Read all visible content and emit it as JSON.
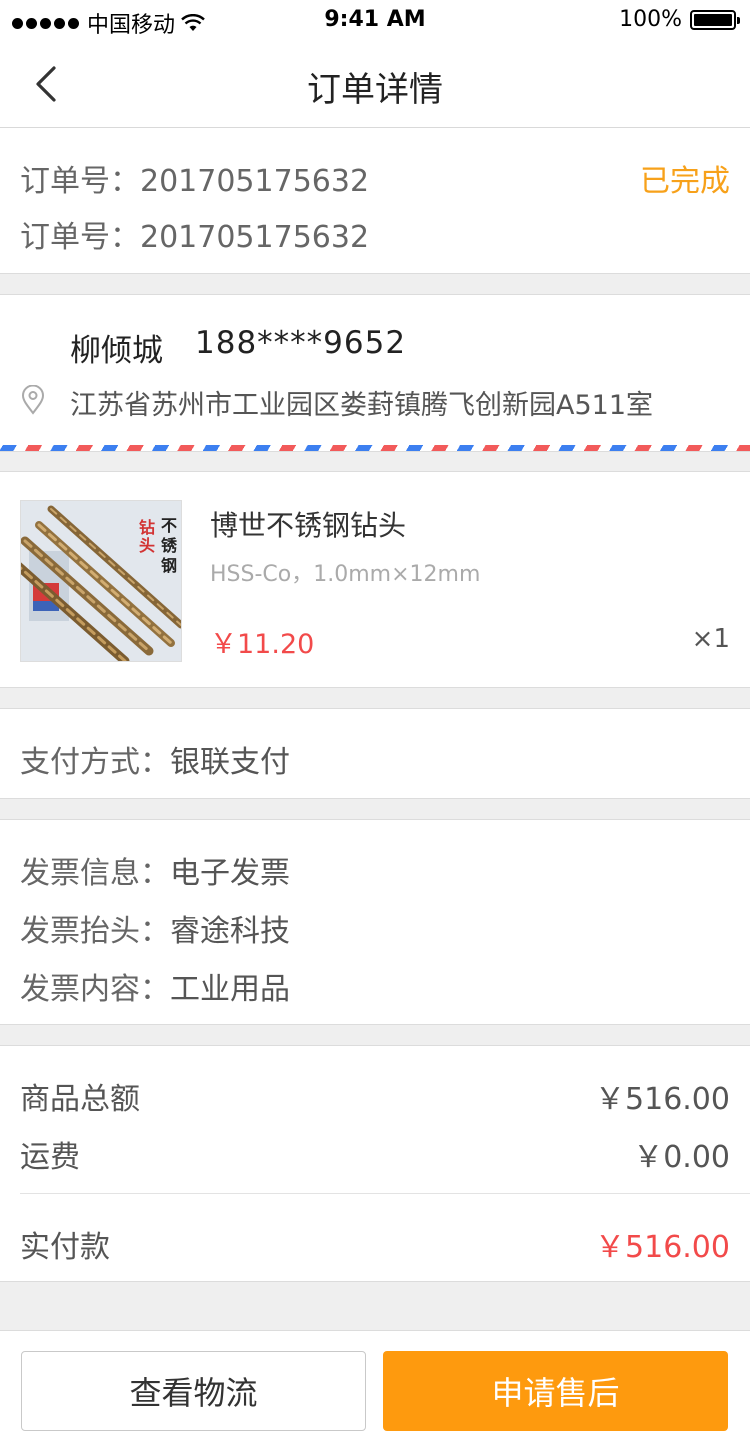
{
  "status_bar": {
    "carrier": "中国移动",
    "time": "9:41 AM",
    "battery": "100%"
  },
  "nav": {
    "title": "订单详情",
    "back_icon": "chevron-left-icon"
  },
  "order": {
    "number_label": "订单号：",
    "number": "201705175632",
    "second_label": "订单号：",
    "second_number": "201705175632",
    "status": "已完成",
    "status_color": "#f7a11a"
  },
  "address": {
    "name": "柳倾城",
    "phone": "188****9652",
    "location_icon": "location-pin-icon",
    "detail": "江苏省苏州市工业园区娄葑镇腾飞创新园A511室"
  },
  "product": {
    "image_text": "钻头 不锈钢",
    "name": "博世不锈钢钻头",
    "spec": "HSS-Co，1.0mm×12mm",
    "price": "￥11.20",
    "qty": "×1"
  },
  "payment": {
    "label": "支付方式：",
    "value": "银联支付"
  },
  "invoice": {
    "rows": [
      {
        "label": "发票信息：",
        "value": "电子发票"
      },
      {
        "label": "发票抬头：",
        "value": "睿途科技"
      },
      {
        "label": "发票内容：",
        "value": "工业用品"
      }
    ]
  },
  "summary": {
    "goods_label": "商品总额",
    "goods_value": "￥516.00",
    "freight_label": "运费",
    "freight_value": "￥0.00",
    "paid_label": "实付款",
    "paid_value": "￥516.00",
    "accent_red": "#f24a4a"
  },
  "actions": {
    "logistics": "查看物流",
    "after_sale": "申请售后",
    "after_sale_color": "#fe9a0e"
  }
}
